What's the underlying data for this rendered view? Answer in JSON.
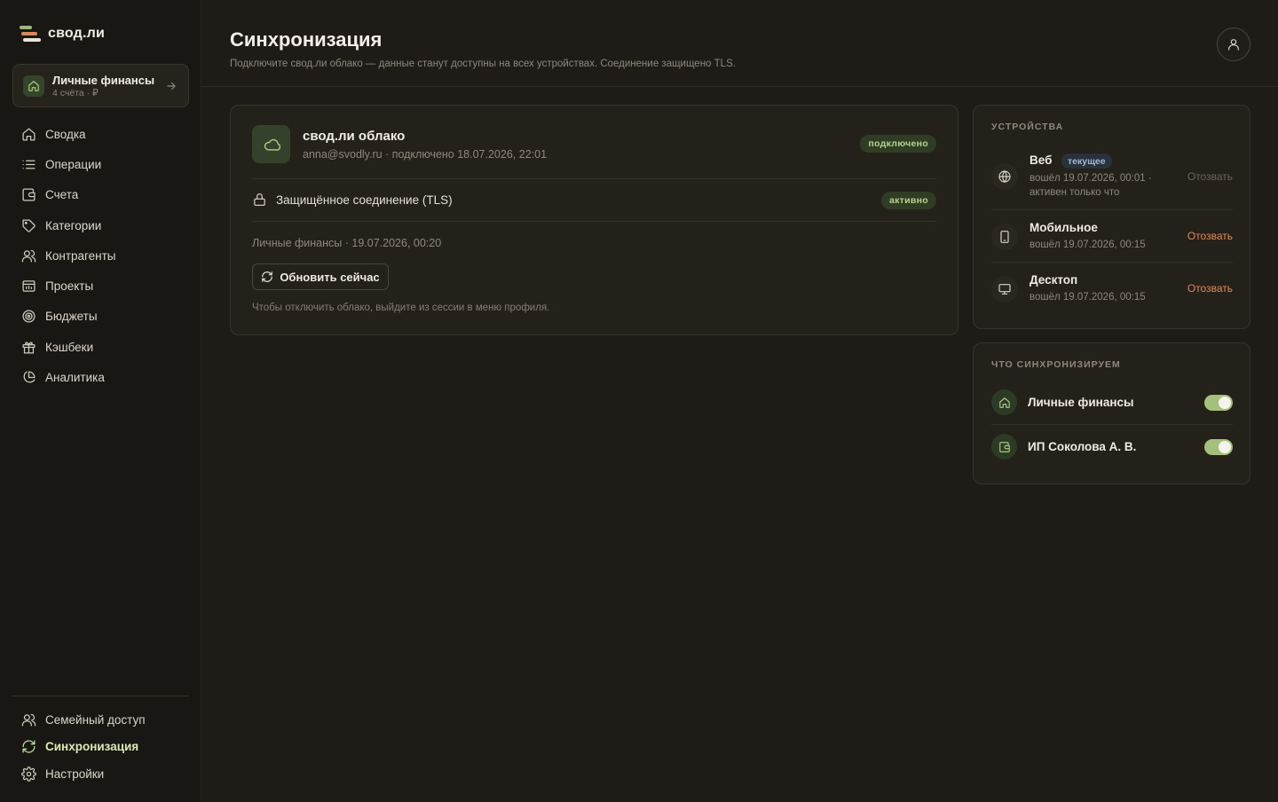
{
  "app": {
    "logo_text": "свод.ли"
  },
  "workspace": {
    "name": "Личные финансы",
    "sub": "4 счёта · ₽"
  },
  "nav": {
    "items": [
      {
        "label": "Сводка",
        "icon": "home-icon"
      },
      {
        "label": "Операции",
        "icon": "list-icon"
      },
      {
        "label": "Счета",
        "icon": "wallet-icon"
      },
      {
        "label": "Категории",
        "icon": "tag-icon"
      },
      {
        "label": "Контрагенты",
        "icon": "users-icon"
      },
      {
        "label": "Проекты",
        "icon": "folder-icon"
      },
      {
        "label": "Бюджеты",
        "icon": "target-icon"
      },
      {
        "label": "Кэшбеки",
        "icon": "gift-icon"
      },
      {
        "label": "Аналитика",
        "icon": "pie-chart-icon"
      }
    ],
    "bottom": [
      {
        "label": "Семейный доступ",
        "icon": "users-icon"
      },
      {
        "label": "Синхронизация",
        "icon": "sync-icon",
        "active": true
      },
      {
        "label": "Настройки",
        "icon": "gear-icon"
      }
    ]
  },
  "header": {
    "title": "Синхронизация",
    "subtitle": "Подключите свод.ли облако — данные станут доступны на всех устройствах. Соединение защищено TLS."
  },
  "cloud": {
    "name": "свод.ли облако",
    "meta": "anna@svodly.ru · подключено 18.07.2026, 22:01",
    "status_badge": "подключено",
    "tls_label": "Защищённое соединение (TLS)",
    "tls_badge": "активно",
    "last_sync": "Личные финансы · 19.07.2026, 00:20",
    "sync_button": "Обновить сейчас",
    "hint": "Чтобы отключить облако, выйдите из сессии в меню профиля."
  },
  "devices": {
    "label": "УСТРОЙСТВА",
    "items": [
      {
        "name": "Веб",
        "tag": "текущее",
        "meta": "вошёл 19.07.2026, 00:01 · активен только что",
        "revoke": "Отозвать",
        "icon": "globe-icon",
        "revoke_disabled": true
      },
      {
        "name": "Мобильное",
        "meta": "вошёл 19.07.2026, 00:15",
        "revoke": "Отозвать",
        "icon": "phone-icon"
      },
      {
        "name": "Десктоп",
        "meta": "вошёл 19.07.2026, 00:15",
        "revoke": "Отозвать",
        "icon": "monitor-icon"
      }
    ]
  },
  "sync_targets": {
    "label": "ЧТО СИНХРОНИЗИРУЕМ",
    "items": [
      {
        "name": "Личные финансы",
        "enabled": true,
        "icon": "home-icon"
      },
      {
        "name": "ИП Соколова А. В.",
        "enabled": true,
        "icon": "wallet-icon"
      }
    ]
  },
  "colors": {
    "accent": "#a4c07b",
    "revoke": "#e08a5a",
    "background": "#1f1c17",
    "sidebar": "#191714"
  }
}
